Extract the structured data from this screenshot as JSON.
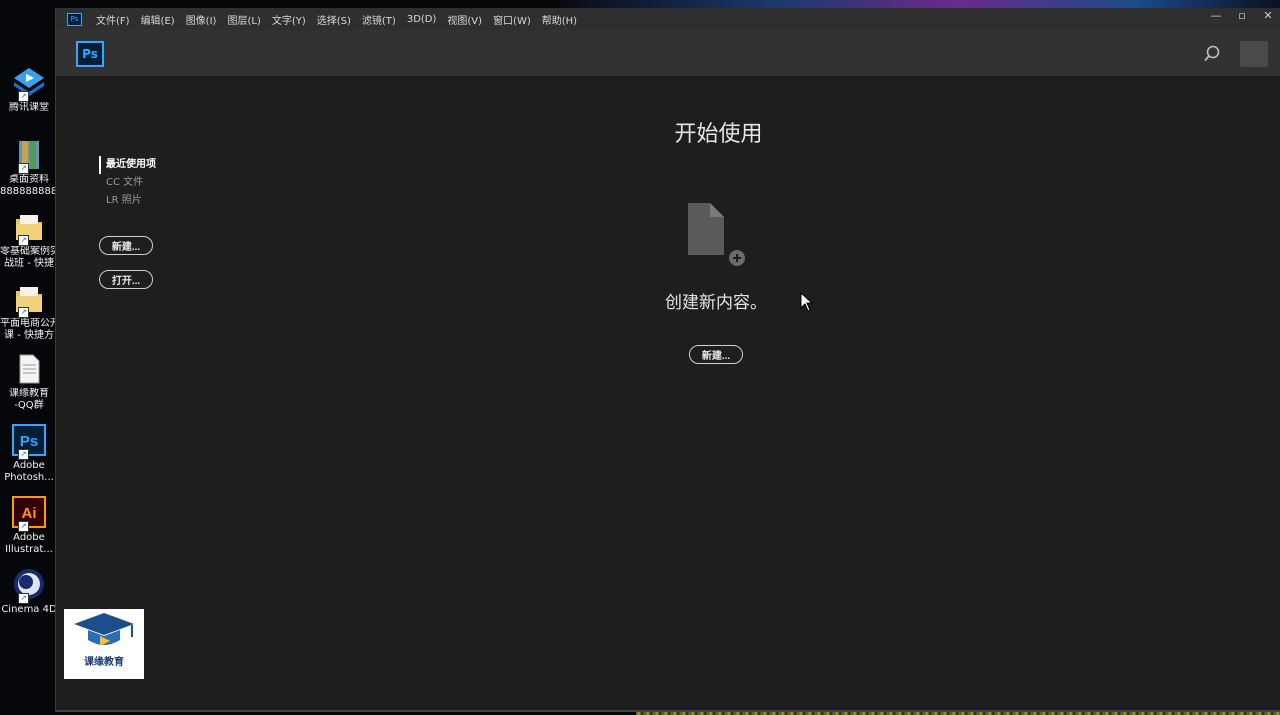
{
  "desktop": {
    "icons": [
      {
        "label": "腾讯课堂",
        "icon": "tencent-classroom-icon"
      },
      {
        "label": "桌面资料\n888888888.",
        "icon": "archive-icon"
      },
      {
        "label": "零基础案例实\n战班 - 快捷",
        "icon": "folder-icon"
      },
      {
        "label": "平面电商公开\n课 - 快捷方",
        "icon": "folder-icon"
      },
      {
        "label": "课缘教育\n-QQ群",
        "icon": "text-file-icon"
      },
      {
        "label": "Adobe\nPhotosh...",
        "icon": "photoshop-icon"
      },
      {
        "label": "Adobe\nIllustrat...",
        "icon": "illustrator-icon"
      },
      {
        "label": "Cinema 4D",
        "icon": "cinema4d-icon"
      }
    ]
  },
  "window": {
    "app_icon_text": "Ps",
    "menu": [
      "文件(F)",
      "编辑(E)",
      "图像(I)",
      "图层(L)",
      "文字(Y)",
      "选择(S)",
      "滤镜(T)",
      "3D(D)",
      "视图(V)",
      "窗口(W)",
      "帮助(H)"
    ],
    "controls": {
      "minimize": "—",
      "maximize": "▫",
      "close": "✕"
    }
  },
  "topbar": {
    "logo": "Ps"
  },
  "sidebar": {
    "items": [
      {
        "label": "最近使用项",
        "active": true
      },
      {
        "label": "CC 文件",
        "active": false
      },
      {
        "label": "LR 照片",
        "active": false
      }
    ],
    "new_button": "新建...",
    "open_button": "打开..."
  },
  "main": {
    "heading": "开始使用",
    "empty_text": "创建新内容。",
    "new_button": "新建..."
  },
  "watermark": {
    "text": "课缘教育"
  },
  "colors": {
    "ps_blue": "#31a8ff",
    "ps_dark": "#001e36",
    "window_bg": "#1e1e1e",
    "menubar_bg": "#2f2f2f",
    "topbar_bg": "#323232"
  }
}
